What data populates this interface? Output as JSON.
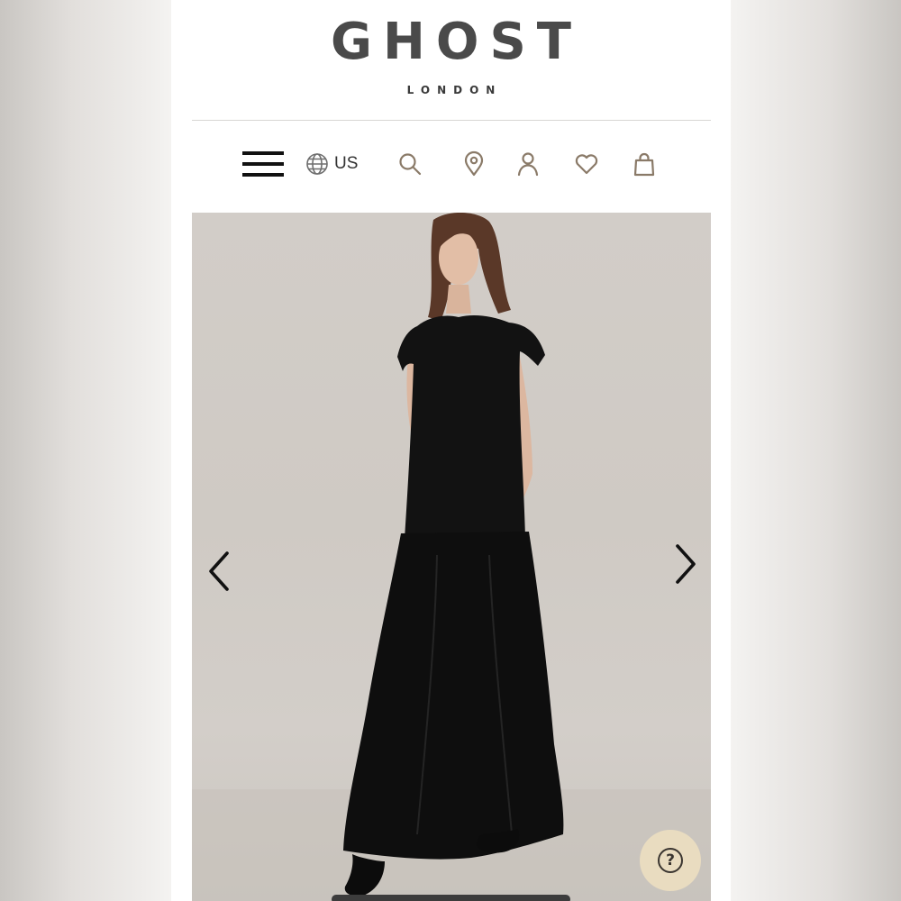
{
  "header": {
    "brand": "GHOST",
    "brand_sub": "LONDON"
  },
  "nav": {
    "region_label": "US",
    "icons": [
      "menu-icon",
      "globe-icon",
      "search-icon",
      "location-pin-icon",
      "account-icon",
      "heart-icon",
      "shopping-bag-icon"
    ]
  },
  "gallery": {
    "image_subject": "model-in-black-top-and-maxi-skirt",
    "controls": [
      "chevron-left-icon",
      "chevron-right-icon"
    ]
  },
  "help": {
    "label": "?"
  },
  "colors": {
    "logo": "#4a4a4a",
    "icon_stroke": "#8a7a68",
    "hero_bg": "#d0cbc5",
    "help_bg": "#e9dcc0"
  }
}
